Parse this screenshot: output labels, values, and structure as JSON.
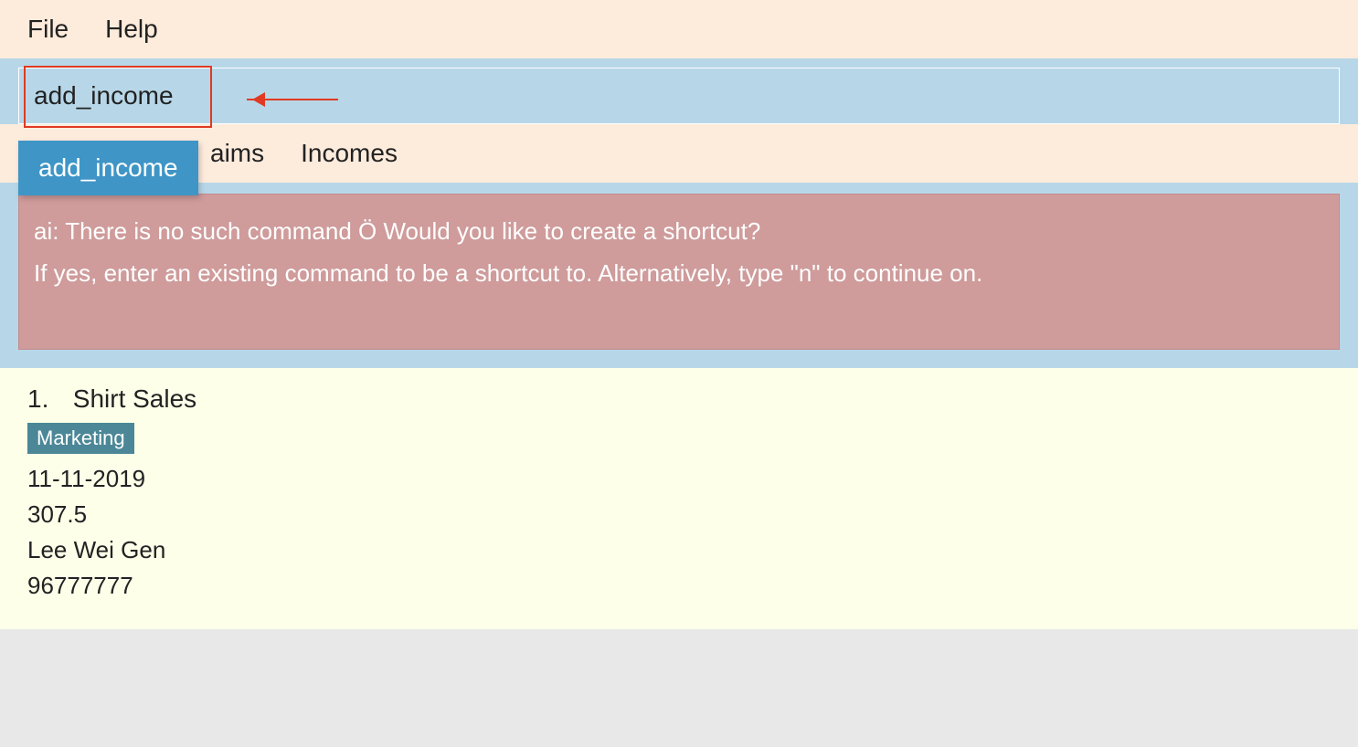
{
  "menubar": {
    "file": "File",
    "help": "Help"
  },
  "command": {
    "value": "add_income",
    "suggestion": "add_income"
  },
  "tabs": {
    "claims": "aims",
    "incomes": "Incomes"
  },
  "feedback": {
    "line1": "ai: There is no such command Ö Would you like to create a shortcut?",
    "line2": "If yes, enter an existing command to be a shortcut to. Alternatively, type \"n\" to continue on."
  },
  "result": {
    "index": "1.",
    "title": "Shirt Sales",
    "tag": "Marketing",
    "date": "11-11-2019",
    "amount": "307.5",
    "name": "Lee Wei Gen",
    "phone": "96777777"
  }
}
